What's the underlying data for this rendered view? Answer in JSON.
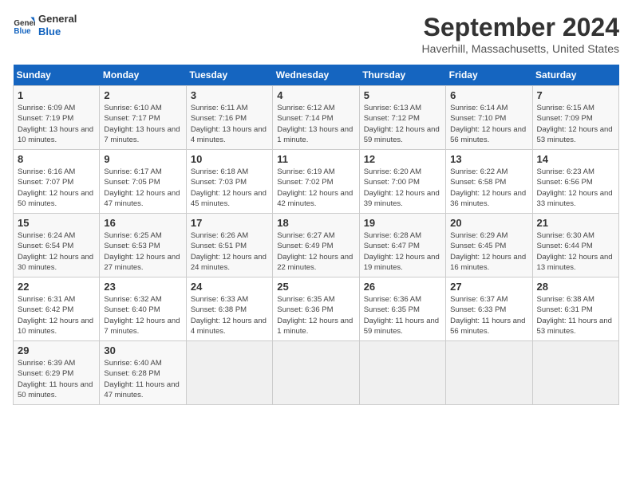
{
  "header": {
    "logo_general": "General",
    "logo_blue": "Blue",
    "month": "September 2024",
    "location": "Haverhill, Massachusetts, United States"
  },
  "weekdays": [
    "Sunday",
    "Monday",
    "Tuesday",
    "Wednesday",
    "Thursday",
    "Friday",
    "Saturday"
  ],
  "weeks": [
    [
      {
        "day": "1",
        "content": "Sunrise: 6:09 AM\nSunset: 7:19 PM\nDaylight: 13 hours and 10 minutes."
      },
      {
        "day": "2",
        "content": "Sunrise: 6:10 AM\nSunset: 7:17 PM\nDaylight: 13 hours and 7 minutes."
      },
      {
        "day": "3",
        "content": "Sunrise: 6:11 AM\nSunset: 7:16 PM\nDaylight: 13 hours and 4 minutes."
      },
      {
        "day": "4",
        "content": "Sunrise: 6:12 AM\nSunset: 7:14 PM\nDaylight: 13 hours and 1 minute."
      },
      {
        "day": "5",
        "content": "Sunrise: 6:13 AM\nSunset: 7:12 PM\nDaylight: 12 hours and 59 minutes."
      },
      {
        "day": "6",
        "content": "Sunrise: 6:14 AM\nSunset: 7:10 PM\nDaylight: 12 hours and 56 minutes."
      },
      {
        "day": "7",
        "content": "Sunrise: 6:15 AM\nSunset: 7:09 PM\nDaylight: 12 hours and 53 minutes."
      }
    ],
    [
      {
        "day": "8",
        "content": "Sunrise: 6:16 AM\nSunset: 7:07 PM\nDaylight: 12 hours and 50 minutes."
      },
      {
        "day": "9",
        "content": "Sunrise: 6:17 AM\nSunset: 7:05 PM\nDaylight: 12 hours and 47 minutes."
      },
      {
        "day": "10",
        "content": "Sunrise: 6:18 AM\nSunset: 7:03 PM\nDaylight: 12 hours and 45 minutes."
      },
      {
        "day": "11",
        "content": "Sunrise: 6:19 AM\nSunset: 7:02 PM\nDaylight: 12 hours and 42 minutes."
      },
      {
        "day": "12",
        "content": "Sunrise: 6:20 AM\nSunset: 7:00 PM\nDaylight: 12 hours and 39 minutes."
      },
      {
        "day": "13",
        "content": "Sunrise: 6:22 AM\nSunset: 6:58 PM\nDaylight: 12 hours and 36 minutes."
      },
      {
        "day": "14",
        "content": "Sunrise: 6:23 AM\nSunset: 6:56 PM\nDaylight: 12 hours and 33 minutes."
      }
    ],
    [
      {
        "day": "15",
        "content": "Sunrise: 6:24 AM\nSunset: 6:54 PM\nDaylight: 12 hours and 30 minutes."
      },
      {
        "day": "16",
        "content": "Sunrise: 6:25 AM\nSunset: 6:53 PM\nDaylight: 12 hours and 27 minutes."
      },
      {
        "day": "17",
        "content": "Sunrise: 6:26 AM\nSunset: 6:51 PM\nDaylight: 12 hours and 24 minutes."
      },
      {
        "day": "18",
        "content": "Sunrise: 6:27 AM\nSunset: 6:49 PM\nDaylight: 12 hours and 22 minutes."
      },
      {
        "day": "19",
        "content": "Sunrise: 6:28 AM\nSunset: 6:47 PM\nDaylight: 12 hours and 19 minutes."
      },
      {
        "day": "20",
        "content": "Sunrise: 6:29 AM\nSunset: 6:45 PM\nDaylight: 12 hours and 16 minutes."
      },
      {
        "day": "21",
        "content": "Sunrise: 6:30 AM\nSunset: 6:44 PM\nDaylight: 12 hours and 13 minutes."
      }
    ],
    [
      {
        "day": "22",
        "content": "Sunrise: 6:31 AM\nSunset: 6:42 PM\nDaylight: 12 hours and 10 minutes."
      },
      {
        "day": "23",
        "content": "Sunrise: 6:32 AM\nSunset: 6:40 PM\nDaylight: 12 hours and 7 minutes."
      },
      {
        "day": "24",
        "content": "Sunrise: 6:33 AM\nSunset: 6:38 PM\nDaylight: 12 hours and 4 minutes."
      },
      {
        "day": "25",
        "content": "Sunrise: 6:35 AM\nSunset: 6:36 PM\nDaylight: 12 hours and 1 minute."
      },
      {
        "day": "26",
        "content": "Sunrise: 6:36 AM\nSunset: 6:35 PM\nDaylight: 11 hours and 59 minutes."
      },
      {
        "day": "27",
        "content": "Sunrise: 6:37 AM\nSunset: 6:33 PM\nDaylight: 11 hours and 56 minutes."
      },
      {
        "day": "28",
        "content": "Sunrise: 6:38 AM\nSunset: 6:31 PM\nDaylight: 11 hours and 53 minutes."
      }
    ],
    [
      {
        "day": "29",
        "content": "Sunrise: 6:39 AM\nSunset: 6:29 PM\nDaylight: 11 hours and 50 minutes."
      },
      {
        "day": "30",
        "content": "Sunrise: 6:40 AM\nSunset: 6:28 PM\nDaylight: 11 hours and 47 minutes."
      },
      {
        "day": "",
        "content": ""
      },
      {
        "day": "",
        "content": ""
      },
      {
        "day": "",
        "content": ""
      },
      {
        "day": "",
        "content": ""
      },
      {
        "day": "",
        "content": ""
      }
    ]
  ]
}
